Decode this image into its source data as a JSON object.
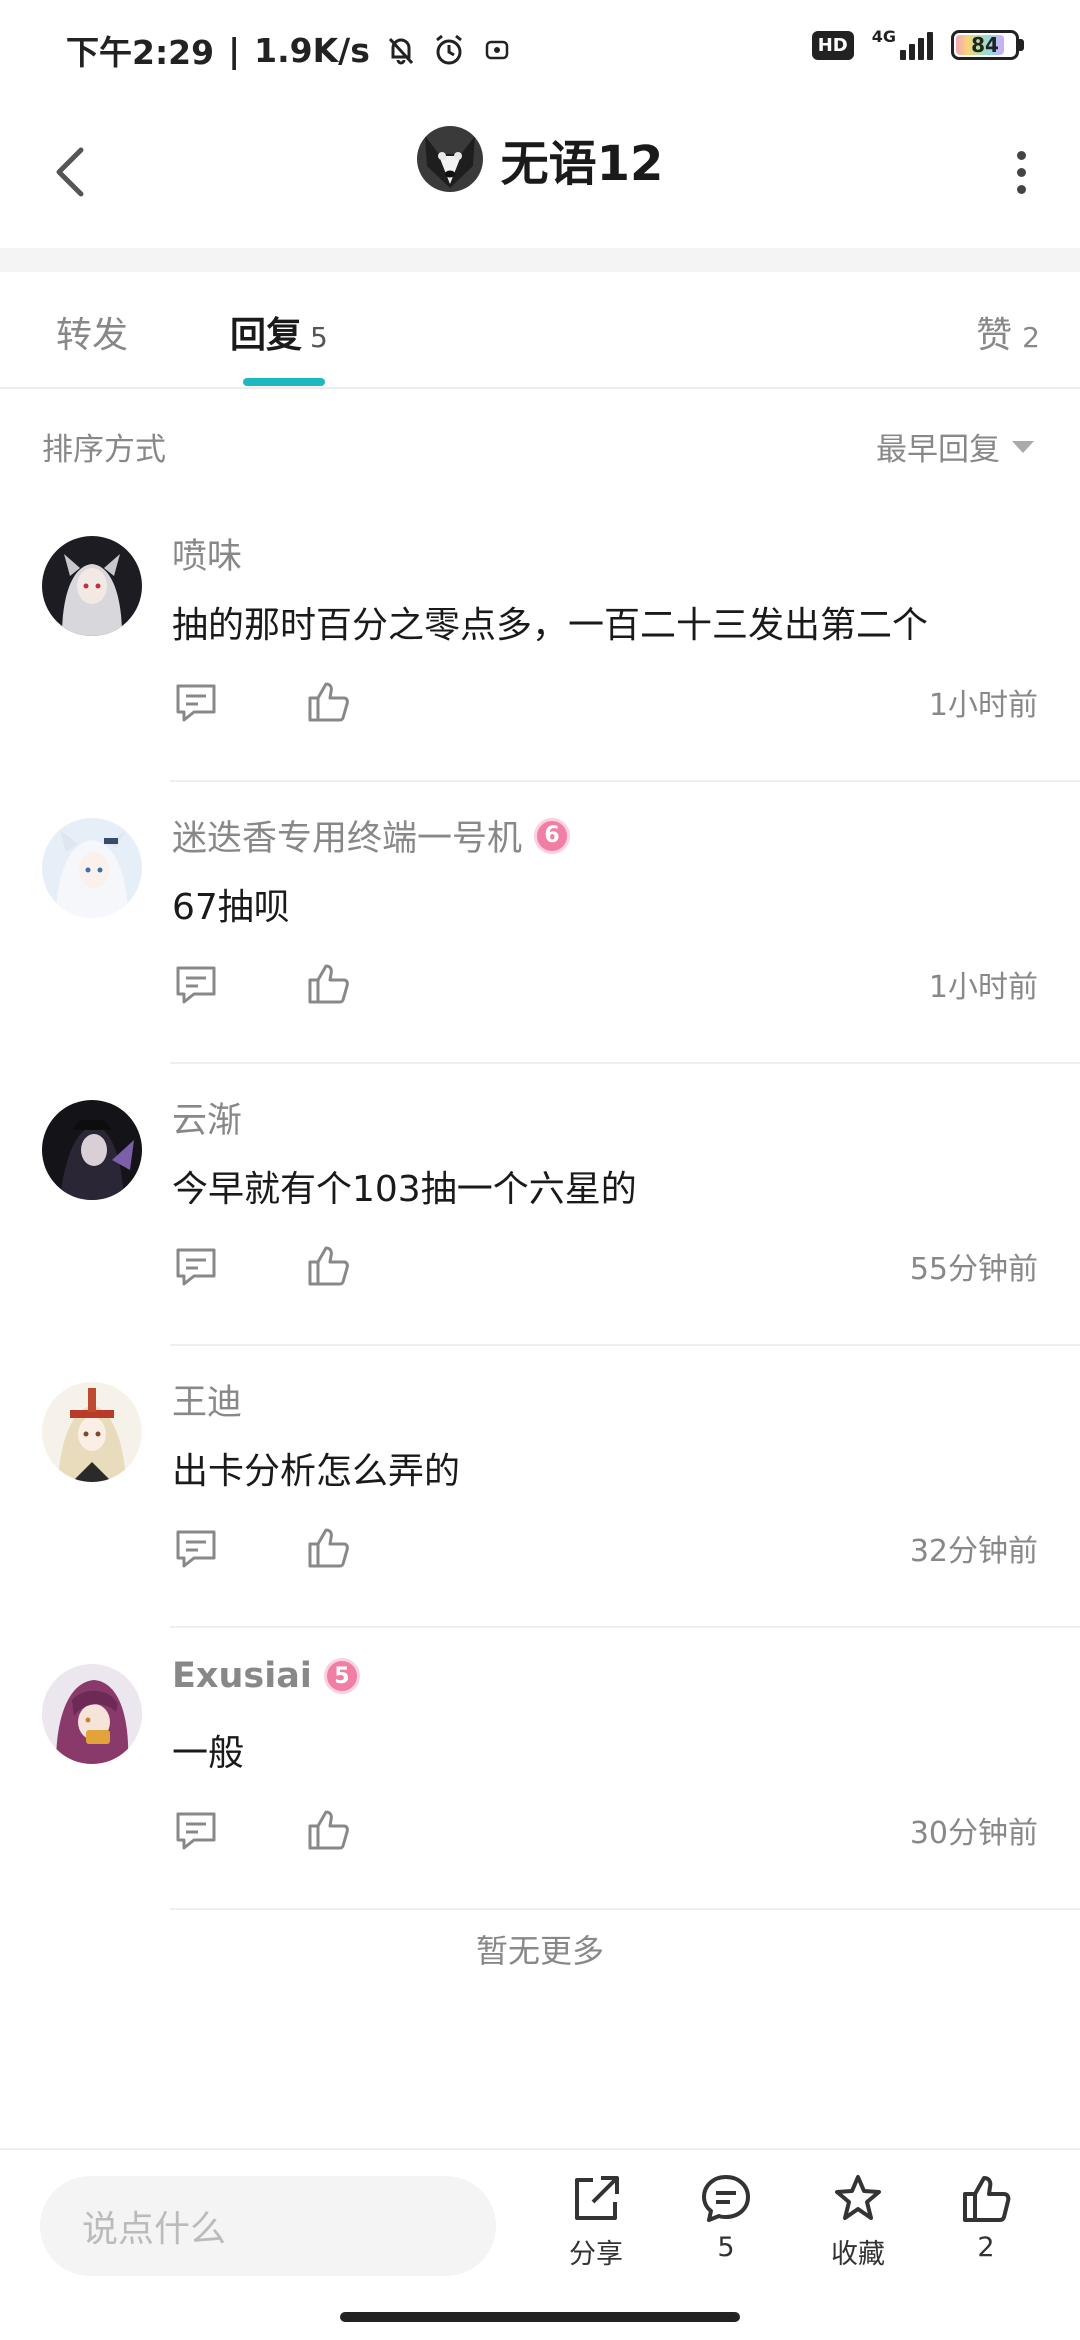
{
  "status_bar": {
    "time": "下午2:29",
    "speed": "1.9K/s",
    "hd": "HD",
    "network": "4G",
    "battery": "84",
    "battery_level": 0.84
  },
  "header": {
    "title": "无语12"
  },
  "tabs": {
    "forward_label": "转发",
    "reply_label": "回复",
    "reply_count": "5",
    "like_label": "赞",
    "like_count": "2"
  },
  "sort": {
    "label": "排序方式",
    "selected": "最早回复"
  },
  "comments": [
    {
      "name": "喷味",
      "text": "抽的那时百分之零点多，一百二十三发出第二个",
      "time": "1小时前"
    },
    {
      "name": "迷迭香专用终端一号机",
      "badge": "6",
      "text": "67抽呗",
      "time": "1小时前"
    },
    {
      "name": "云渐",
      "text": "今早就有个103抽一个六星的",
      "time": "55分钟前"
    },
    {
      "name": "王迪",
      "text": "出卡分析怎么弄的",
      "time": "32分钟前"
    },
    {
      "name": "Exusiai",
      "badge": "5",
      "text": "一般",
      "time": "30分钟前"
    }
  ],
  "end_text": "暂无更多",
  "bottom_bar": {
    "input_placeholder": "说点什么",
    "share_label": "分享",
    "comment_count": "5",
    "fav_label": "收藏",
    "like_count": "2"
  },
  "icons": {
    "back": "back-arrow-icon",
    "more": "more-vertical-icon",
    "reply": "comment-icon",
    "like": "thumbs-up-icon",
    "share": "share-icon",
    "fav": "star-icon"
  },
  "colors": {
    "accent": "#20b8c0",
    "badge": "#f07fa3"
  }
}
